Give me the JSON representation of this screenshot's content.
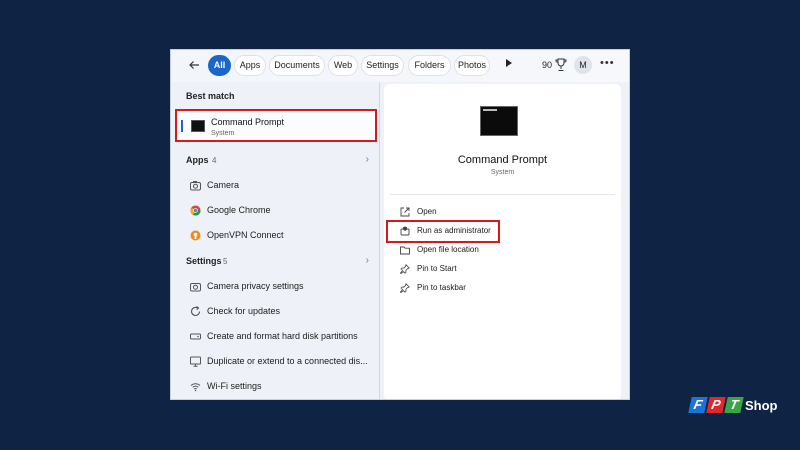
{
  "topbar": {
    "back_icon": "arrow-left-icon",
    "tabs": [
      {
        "label": "All",
        "active": true
      },
      {
        "label": "Apps"
      },
      {
        "label": "Documents"
      },
      {
        "label": "Web"
      },
      {
        "label": "Settings"
      },
      {
        "label": "Folders"
      },
      {
        "label": "Photos"
      }
    ],
    "play_icon": "play-icon",
    "points": "90",
    "trophy_icon": "trophy-icon",
    "avatar": "M",
    "more_icon": "more-icon",
    "more_glyph": "•••"
  },
  "left": {
    "best_match_title": "Best match",
    "best_match": {
      "name": "Command Prompt",
      "sub": "System"
    },
    "apps_title": "Apps",
    "apps_count": "4",
    "apps": [
      {
        "label": "Camera",
        "icon": "camera-icon"
      },
      {
        "label": "Google Chrome",
        "icon": "chrome-icon"
      },
      {
        "label": "OpenVPN Connect",
        "icon": "openvpn-icon"
      }
    ],
    "settings_title": "Settings",
    "settings_count": "5",
    "settings": [
      {
        "label": "Camera privacy settings",
        "icon": "camera-icon"
      },
      {
        "label": "Check for updates",
        "icon": "refresh-icon"
      },
      {
        "label": "Create and format hard disk partitions",
        "icon": "disk-icon"
      },
      {
        "label": "Duplicate or extend to a connected dis...",
        "icon": "monitor-icon"
      },
      {
        "label": "Wi-Fi settings",
        "icon": "wifi-icon"
      }
    ]
  },
  "right": {
    "title": "Command Prompt",
    "sub": "System",
    "actions": [
      {
        "label": "Open",
        "icon": "open-icon"
      },
      {
        "label": "Run as administrator",
        "icon": "shield-icon"
      },
      {
        "label": "Open file location",
        "icon": "folder-icon"
      },
      {
        "label": "Pin to Start",
        "icon": "pin-icon"
      },
      {
        "label": "Pin to taskbar",
        "icon": "pin-icon"
      }
    ]
  },
  "logo": {
    "letters": [
      "F",
      "P",
      "T"
    ],
    "shop": "Shop"
  },
  "colors": {
    "accent": "#1a66c9",
    "highlight": "#d7191f",
    "background": "#0f2344"
  }
}
